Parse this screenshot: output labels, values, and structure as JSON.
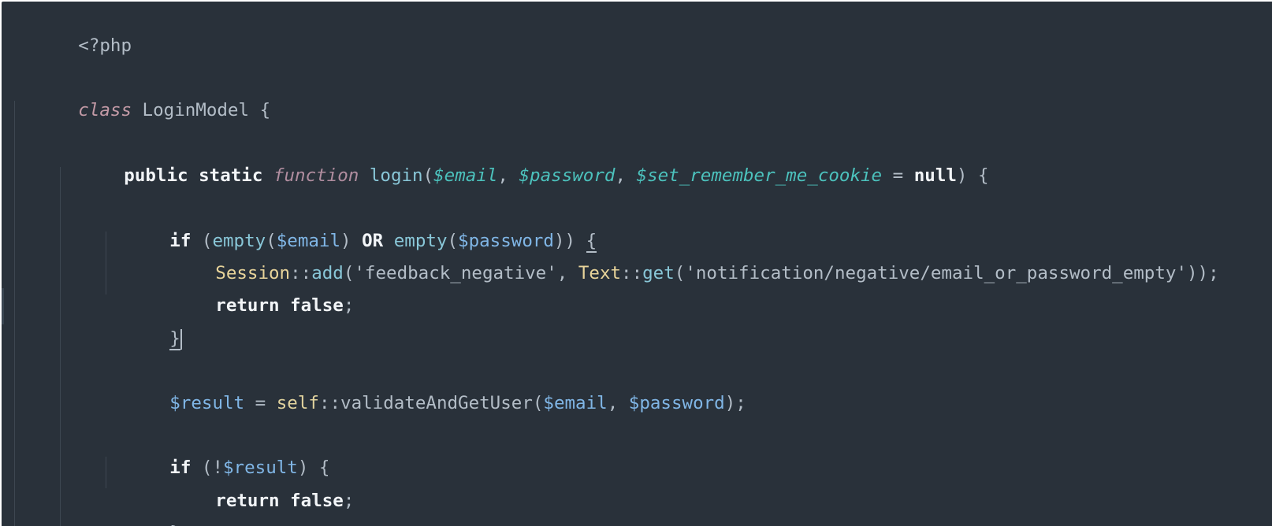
{
  "editor": {
    "language": "php",
    "background": "#29313a",
    "lines": {
      "l1": {
        "t": "<?php"
      },
      "l3": {
        "kw": "class",
        "name": " LoginModel ",
        "brace": "{"
      },
      "l5": {
        "public": "public",
        "static": "static",
        "function": "function",
        "name": "login",
        "open": "(",
        "p1": "$email",
        "sep1": ", ",
        "p2": "$password",
        "sep2": ", ",
        "p3": "$set_remember_me_cookie",
        "eq": " = ",
        "null": "null",
        "close": ") {"
      },
      "l7": {
        "if": "if",
        "open": " (",
        "empty1": "empty",
        "po1": "(",
        "v1": "$email",
        "pc1": ") ",
        "or": "OR",
        "sp": " ",
        "empty2": "empty",
        "po2": "(",
        "v2": "$password",
        "pc2": ")) ",
        "brace": "{"
      },
      "l8": {
        "session": "Session",
        "dc1": "::",
        "add": "add",
        "a1": "('feedback_negative', ",
        "text": "Text",
        "dc2": "::",
        "get": "get",
        "a2": "('notification/negative/email_or_password_empty'));"
      },
      "l9": {
        "return": "return",
        "false": " false",
        "semi": ";"
      },
      "l10": {
        "brace": "}"
      },
      "l12": {
        "var": "$result",
        "eq": " = ",
        "self": "self",
        "dc": "::",
        "method": "validateAndGetUser",
        "open": "(",
        "v1": "$email",
        "sep": ", ",
        "v2": "$password",
        "close": ");"
      },
      "l14": {
        "if": "if",
        "open": " (!",
        "var": "$result",
        "close": ") {"
      },
      "l15": {
        "return": "return",
        "false": " false",
        "semi": ";"
      },
      "l16": {
        "brace": "}"
      }
    }
  }
}
